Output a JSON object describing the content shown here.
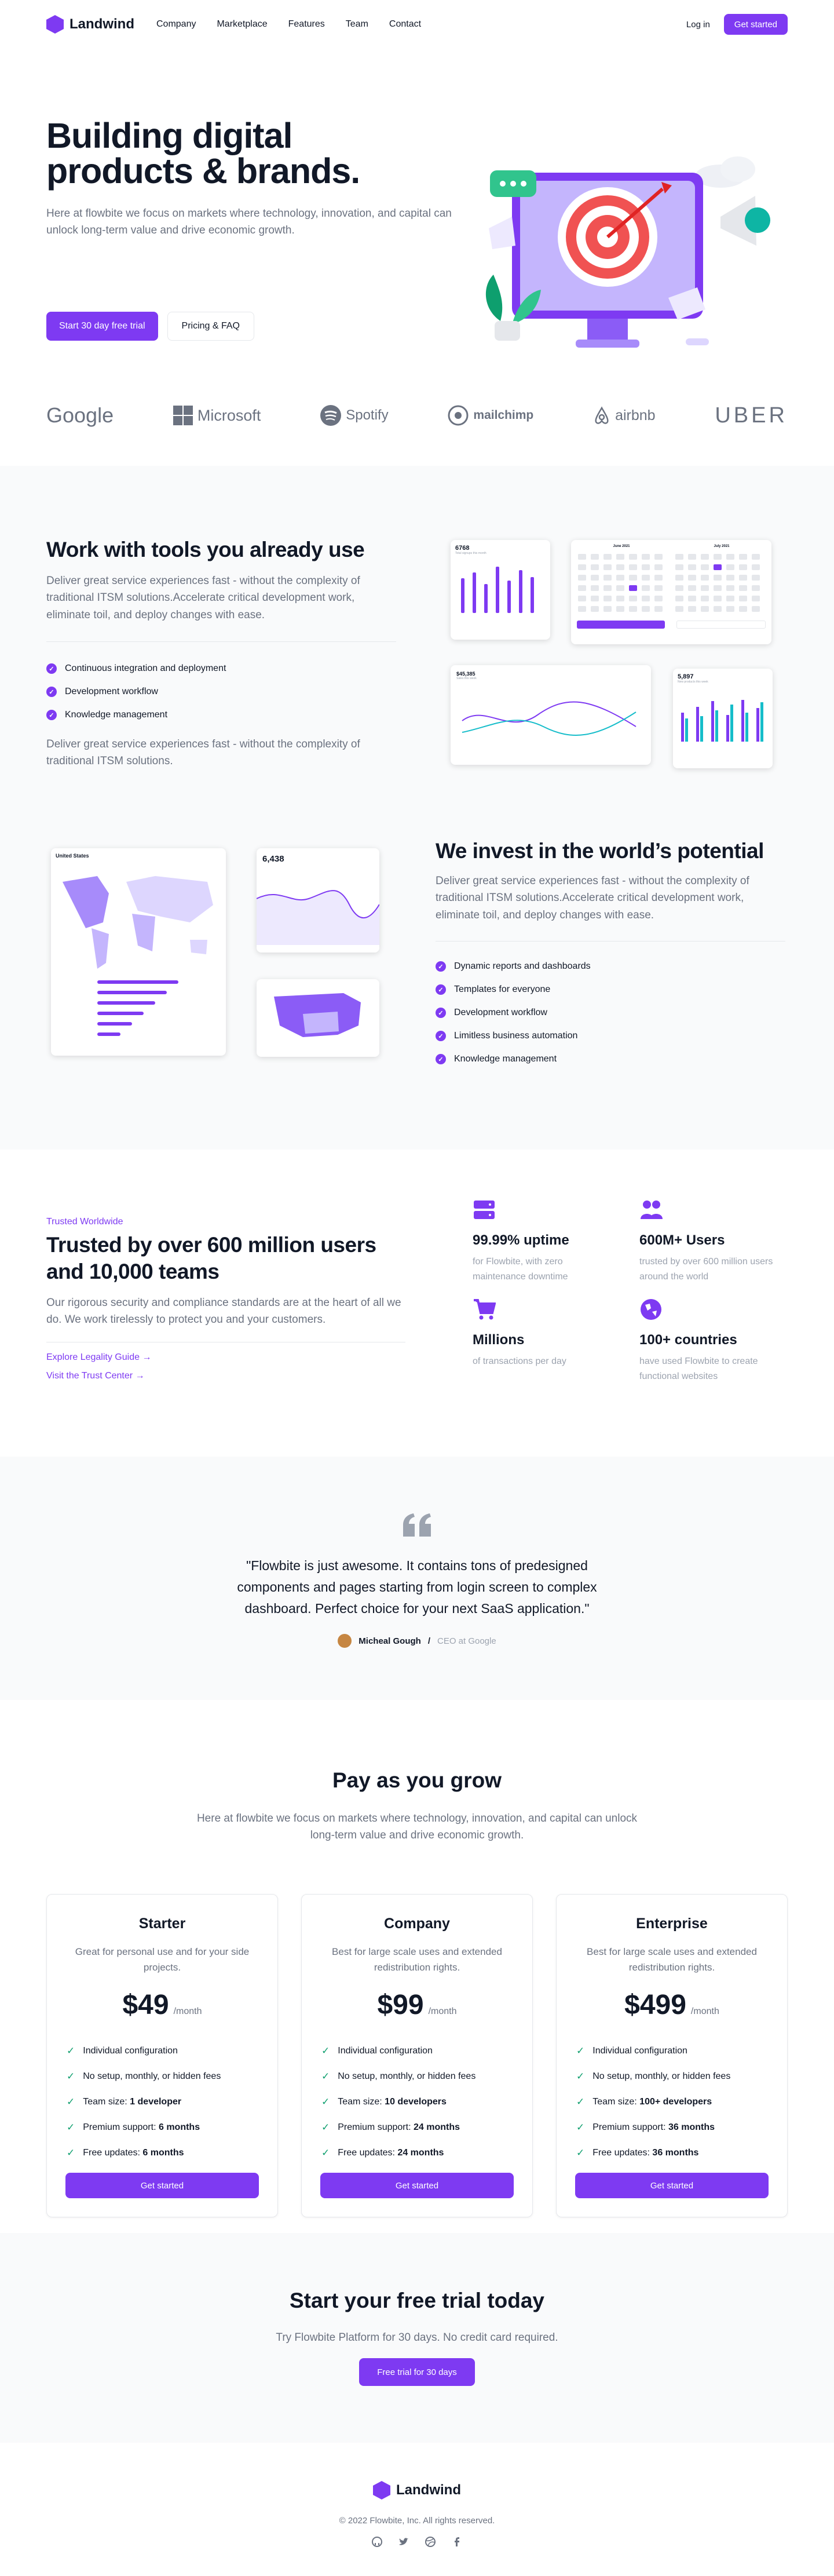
{
  "brand": {
    "name": "Landwind"
  },
  "nav": [
    "Company",
    "Marketplace",
    "Features",
    "Team",
    "Contact"
  ],
  "header": {
    "login": "Log in",
    "cta": "Get started"
  },
  "hero": {
    "title_line1": "Building digital",
    "title_line2": "products & brands.",
    "subtitle": "Here at flowbite we focus on markets where technology, innovation, and capital can unlock long-term value and drive economic growth.",
    "primary_cta": "Start 30 day free trial",
    "secondary_cta": "Pricing & FAQ"
  },
  "logos": [
    "Google",
    "Microsoft",
    "Spotify",
    "mailchimp",
    "airbnb",
    "UBER"
  ],
  "tools": {
    "title": "Work with tools you already use",
    "text": "Deliver great service experiences fast - without the complexity of traditional ITSM solutions.Accelerate critical development work, eliminate toil, and deploy changes with ease.",
    "checks": [
      "Continuous integration and deployment",
      "Development workflow",
      "Knowledge management"
    ],
    "footnote": "Deliver great service experiences fast - without the complexity of traditional ITSM solutions.",
    "card1": {
      "value": "6768",
      "label": "Total signups this month"
    },
    "calendar1": {
      "title": "June 2021"
    },
    "calendar2": {
      "title": "July 2021"
    },
    "card3": {
      "value": "$45,385",
      "label": "Sales this week"
    },
    "card4": {
      "value": "5,897",
      "label": "New products this week"
    }
  },
  "invest": {
    "title": "We invest in the world’s potential",
    "text": "Deliver great service experiences fast - without the complexity of traditional ITSM solutions.Accelerate critical development work, eliminate toil, and deploy changes with ease.",
    "checks": [
      "Dynamic reports and dashboards",
      "Templates for everyone",
      "Development workflow",
      "Limitless business automation",
      "Knowledge management"
    ],
    "map_title": "United States",
    "visitors": {
      "value": "6,438"
    }
  },
  "trust": {
    "eyebrow": "Trusted Worldwide",
    "title": "Trusted by over 600 million users and 10,000 teams",
    "text": "Our rigorous security and compliance standards are at the heart of all we do. We work tirelessly to protect you and your customers.",
    "link1": "Explore Legality Guide",
    "link2": "Visit the Trust Center",
    "features": [
      {
        "title": "99.99% uptime",
        "text": "for Flowbite, with zero maintenance downtime"
      },
      {
        "title": "600M+ Users",
        "text": "trusted by over 600 million users around the world"
      },
      {
        "title": "Millions",
        "text": "of transactions per day"
      },
      {
        "title": "100+ countries",
        "text": "have used Flowbite to create functional websites"
      }
    ]
  },
  "quote": {
    "text": "\"Flowbite is just awesome. It contains tons of predesigned components and pages starting from login screen to complex dashboard. Perfect choice for your next SaaS application.\"",
    "author": "Micheal Gough",
    "role": "CEO at Google"
  },
  "pricing": {
    "title": "Pay as you grow",
    "subtitle": "Here at flowbite we focus on markets where technology, innovation, and capital can unlock long-term value and drive economic growth.",
    "plans": [
      {
        "name": "Starter",
        "desc": "Great for personal use and for your side projects.",
        "price": "$49",
        "per": "/month",
        "f1": "Individual configuration",
        "f2": "No setup, monthly, or hidden fees",
        "f3a": "Team size: ",
        "f3b": "1 developer",
        "f4a": "Premium support: ",
        "f4b": "6 months",
        "f5a": "Free updates: ",
        "f5b": "6 months",
        "cta": "Get started"
      },
      {
        "name": "Company",
        "desc": "Best for large scale uses and extended redistribution rights.",
        "price": "$99",
        "per": "/month",
        "f1": "Individual configuration",
        "f2": "No setup, monthly, or hidden fees",
        "f3a": "Team size: ",
        "f3b": "10 developers",
        "f4a": "Premium support: ",
        "f4b": "24 months",
        "f5a": "Free updates: ",
        "f5b": "24 months",
        "cta": "Get started"
      },
      {
        "name": "Enterprise",
        "desc": "Best for large scale uses and extended redistribution rights.",
        "price": "$499",
        "per": "/month",
        "f1": "Individual configuration",
        "f2": "No setup, monthly, or hidden fees",
        "f3a": "Team size: ",
        "f3b": "100+ developers",
        "f4a": "Premium support: ",
        "f4b": "36 months",
        "f5a": "Free updates: ",
        "f5b": "36 months",
        "cta": "Get started"
      }
    ]
  },
  "cta": {
    "title": "Start your free trial today",
    "text": "Try Flowbite Platform for 30 days. No credit card required.",
    "button": "Free trial for 30 days"
  },
  "footer": {
    "copyright": "© 2022 Flowbite, Inc. All rights reserved."
  },
  "colors": {
    "accent": "#7e3af2",
    "check": "#0e9f6e"
  }
}
